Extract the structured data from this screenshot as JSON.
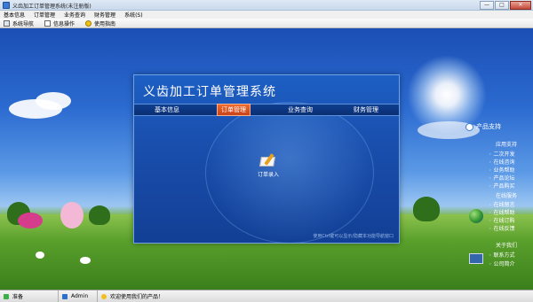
{
  "window": {
    "title": "义齿加工订单管理系统(未注册版)",
    "controls": [
      "—",
      "□",
      "✕"
    ]
  },
  "menu": [
    "基本信息",
    "订单管理",
    "业务查询",
    "财务管理",
    "系统(S)"
  ],
  "toolbar": [
    {
      "label": "系统导航",
      "icon": "system-nav-icon"
    },
    {
      "label": "信息操作",
      "icon": "info-op-icon"
    },
    {
      "label": "使用指南",
      "icon": "help-icon"
    }
  ],
  "panel": {
    "title": "义齿加工订单管理系统",
    "tabs": [
      "基本信息",
      "订单管理",
      "业务查询",
      "财务管理"
    ],
    "active_tab": "订单管理",
    "tile_label": "订单录入",
    "hint": "使用Ctrl键可以显示/隐藏本功能导航窗口"
  },
  "side": {
    "heading": "产品支持",
    "groups": [
      "应用支持",
      "在线服务",
      "关于我们"
    ],
    "items_app": [
      "二次开发",
      "在线咨询",
      "业务帮助",
      "产品论坛",
      "产品购买"
    ],
    "items_online": [
      "在线留言",
      "在线帮助",
      "在线订购",
      "在线反馈"
    ],
    "items_about": [
      "联系方式",
      "公司简介"
    ]
  },
  "status": {
    "user_label": "准备",
    "user_name": "Admin",
    "message": "欢迎使用我们的产品！"
  }
}
